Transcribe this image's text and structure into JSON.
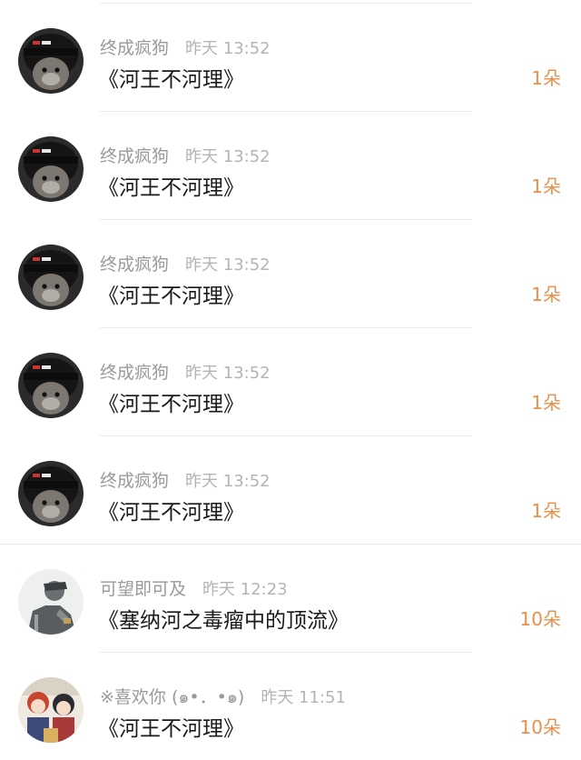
{
  "gifts": [
    {
      "user": "终成疯狗",
      "time": "昨天 13:52",
      "title": "《河王不河理》",
      "count": "1朵",
      "avatar": "helmet-cat"
    },
    {
      "user": "终成疯狗",
      "time": "昨天 13:52",
      "title": "《河王不河理》",
      "count": "1朵",
      "avatar": "helmet-cat"
    },
    {
      "user": "终成疯狗",
      "time": "昨天 13:52",
      "title": "《河王不河理》",
      "count": "1朵",
      "avatar": "helmet-cat"
    },
    {
      "user": "终成疯狗",
      "time": "昨天 13:52",
      "title": "《河王不河理》",
      "count": "1朵",
      "avatar": "helmet-cat"
    },
    {
      "user": "终成疯狗",
      "time": "昨天 13:52",
      "title": "《河王不河理》",
      "count": "1朵",
      "avatar": "helmet-cat"
    },
    {
      "user": "可望即可及",
      "time": "昨天 12:23",
      "title": "《塞纳河之毒瘤中的顶流》",
      "count": "10朵",
      "avatar": "sketch-figure"
    },
    {
      "user": "※喜欢你 (๑•．•๑)",
      "time": "昨天 11:51",
      "title": "《河王不河理》",
      "count": "10朵",
      "avatar": "anime-pair"
    }
  ],
  "colors": {
    "count": "#e8904a",
    "meta": "#9a9a9a",
    "title": "#1a1a1a",
    "divider": "#ececec"
  }
}
